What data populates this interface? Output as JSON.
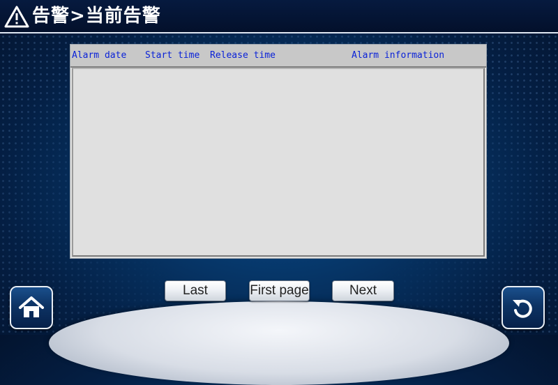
{
  "header": {
    "title": "告警>当前告警",
    "warning_icon": "warning-triangle-icon"
  },
  "alarm_table": {
    "columns": [
      "Alarm date",
      "Start time",
      "Release time",
      "Alarm information"
    ],
    "rows": []
  },
  "pagination": {
    "last_label": "Last",
    "first_page_label": "First page",
    "next_label": "Next"
  },
  "nav": {
    "home_icon": "home-icon",
    "back_icon": "back-arrow-icon"
  },
  "colors": {
    "header_bg": "#03102b",
    "column_header_text": "#0a22d8",
    "table_bg": "#e0e0e0"
  }
}
